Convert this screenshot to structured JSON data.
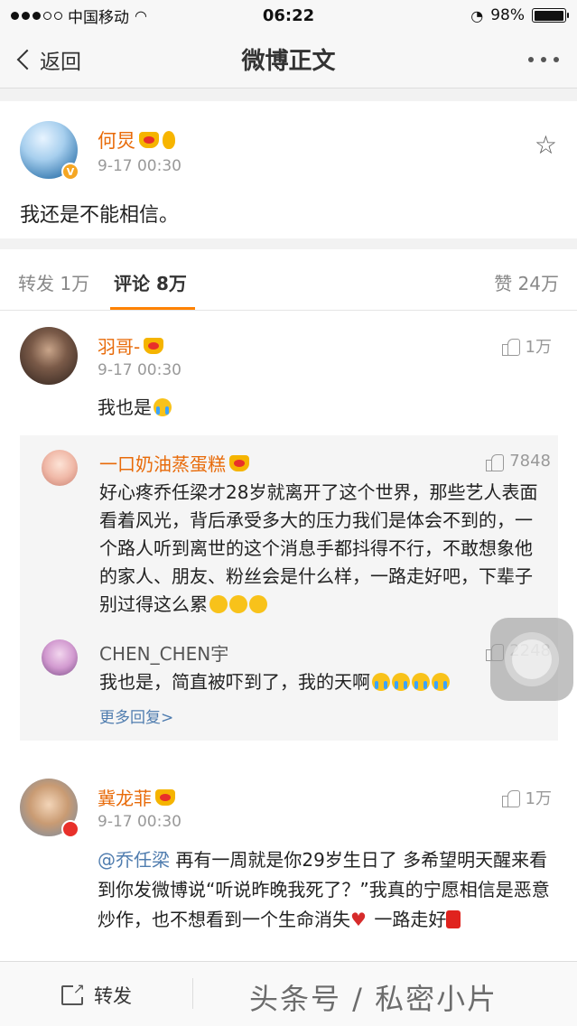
{
  "status_bar": {
    "carrier": "中国移动",
    "time": "06:22",
    "battery": "98%",
    "battery_level": 0.98
  },
  "nav": {
    "back_label": "返回",
    "title": "微博正文"
  },
  "post": {
    "username": "何炅",
    "verified_badge": "V",
    "time": "9-17 00:30",
    "text": "我还是不能相信。"
  },
  "tabs": {
    "repost": "转发 1万",
    "comments": "评论 8万",
    "likes": "赞 24万"
  },
  "comments": [
    {
      "username": "羽哥-",
      "time": "9-17 00:30",
      "likes": "1万",
      "text": "我也是",
      "replies": [
        {
          "username": "一口奶油蒸蛋糕",
          "likes": "7848",
          "text": "好心疼乔任梁才28岁就离开了这个世界，那些艺人表面看着风光，背后承受多大的压力我们是体会不到的，一个路人听到离世的这个消息手都抖得不行，不敢想象他的家人、朋友、粉丝会是什么样，一路走好吧，下辈子别过得这么累"
        },
        {
          "username": "CHEN_CHEN宇",
          "likes": "2248",
          "text": "我也是，简直被吓到了，我的天啊"
        }
      ],
      "more_replies": "更多回复>"
    },
    {
      "username": "冀龙菲",
      "time": "9-17 00:30",
      "likes": "1万",
      "mention": "@乔任梁",
      "text": " 再有一周就是你29岁生日了 多希望明天醒来看到你发微博说“听说昨晚我死了？”我真的宁愿相信是恶意炒作，也不想看到一个生命消失",
      "text_tail": " 一路走好"
    }
  ],
  "bottom_bar": {
    "repost_label": "转发",
    "watermark": "头条号 / 私密小片"
  },
  "icons": [
    "signal-dots",
    "wifi-icon",
    "lock-rotation-icon",
    "battery-icon",
    "back-chevron-icon",
    "more-icon",
    "star-icon",
    "thumb-up-icon",
    "share-icon"
  ],
  "colors": {
    "accent_orange": "#ff8200",
    "username_orange": "#e86b0a",
    "link_blue": "#507daf"
  }
}
